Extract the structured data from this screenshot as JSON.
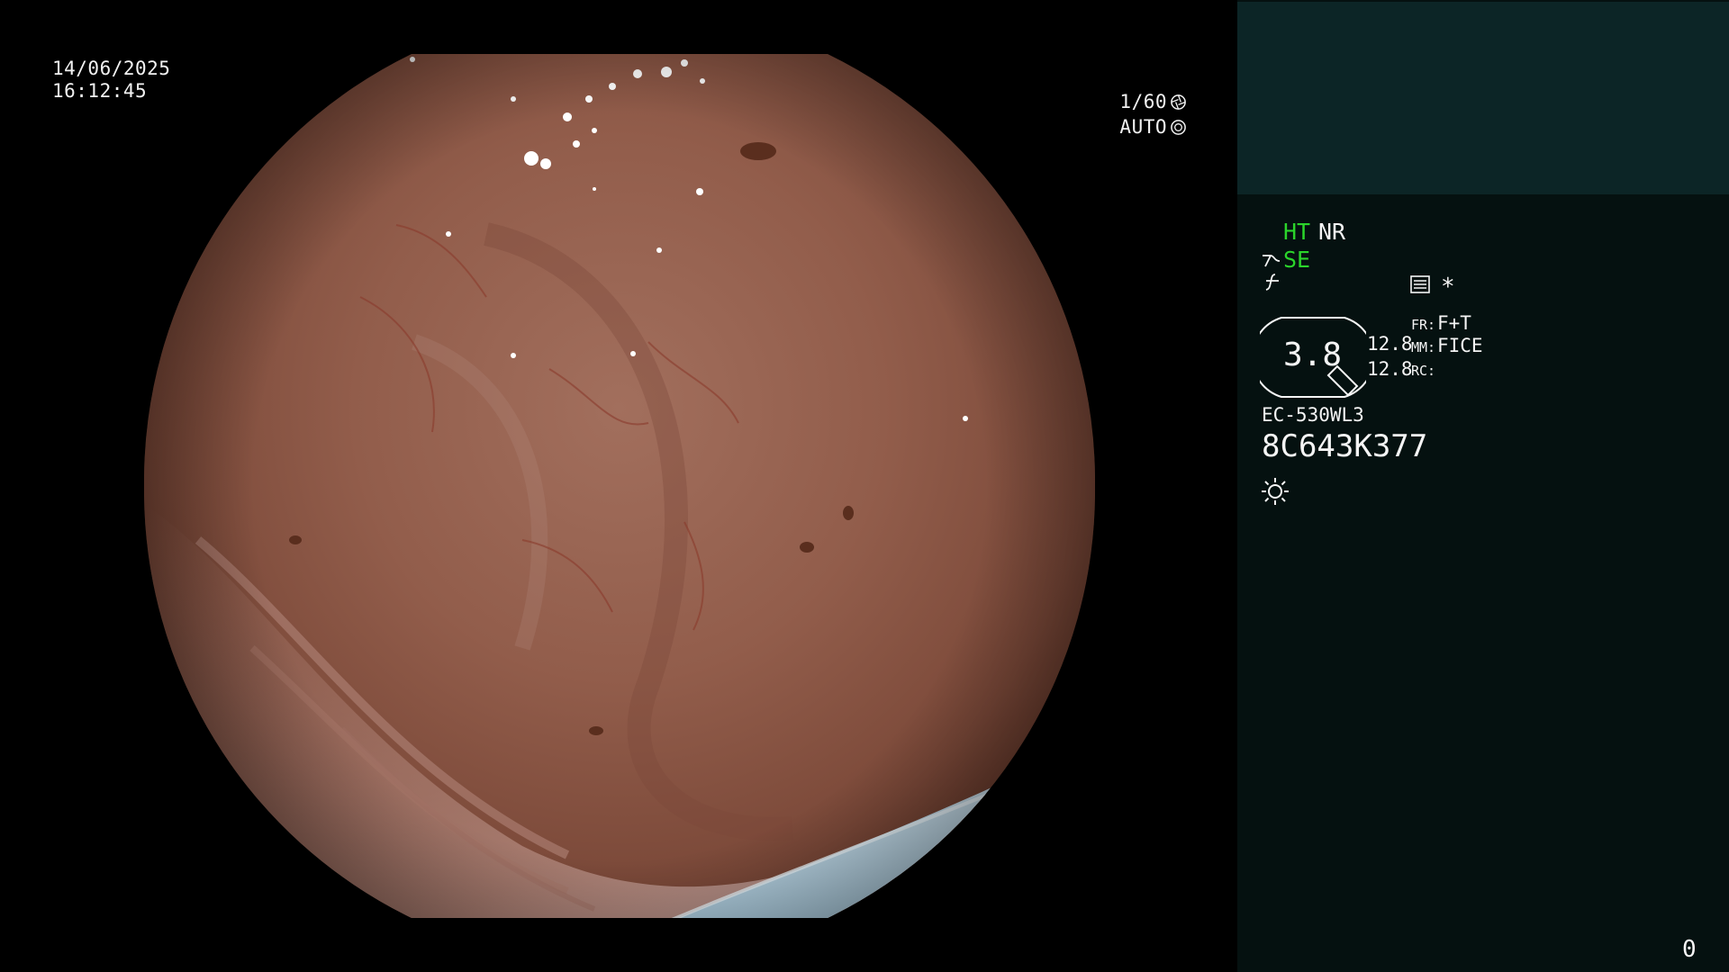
{
  "osd": {
    "date": "14/06/2025",
    "time": "16:12:45",
    "shutter": "1/60",
    "iris": "AUTO"
  },
  "panel": {
    "modes": {
      "ht": "HT",
      "nr": "NR",
      "se": "SE",
      "asterisk": "*"
    },
    "zoom": "3.8",
    "values": [
      "12.8",
      "12.8"
    ],
    "labels": {
      "fr": "FR:",
      "mm": "MM:",
      "rc": "RC:"
    },
    "fr_value": "F+T",
    "mm_value": "FICE",
    "scope_model": "EC-530WL3",
    "scope_serial": "8C643K377",
    "counter": "0"
  },
  "colors": {
    "panel_bg": "#051110",
    "panel_top_bg": "#0c2526",
    "active_mode": "#2bd42b",
    "osd_text": "#f2f2f2"
  },
  "icons": {
    "shutter": "aperture-icon",
    "iris": "iris-icon",
    "se": "structure-enhance-icon",
    "f": "function-icon",
    "list": "settings-list-icon",
    "light": "light-source-icon"
  }
}
